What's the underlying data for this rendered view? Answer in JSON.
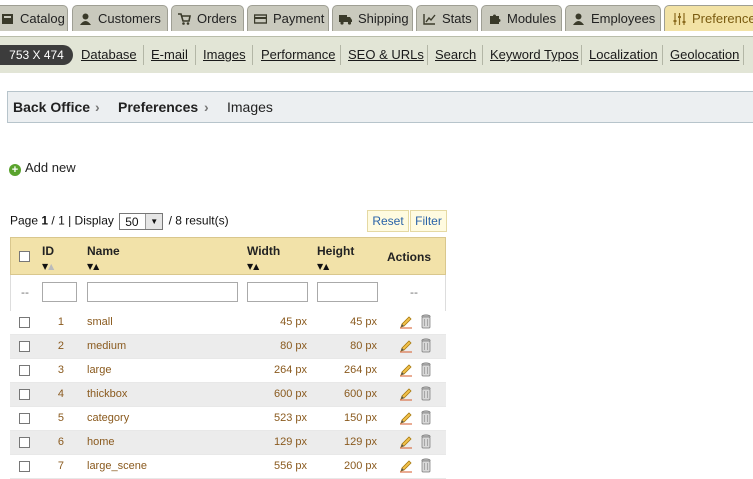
{
  "tabs": [
    {
      "label": "Catalog",
      "icon": "catalog-icon"
    },
    {
      "label": "Customers",
      "icon": "customers-icon"
    },
    {
      "label": "Orders",
      "icon": "cart-icon"
    },
    {
      "label": "Payment",
      "icon": "payment-card-icon"
    },
    {
      "label": "Shipping",
      "icon": "truck-icon"
    },
    {
      "label": "Stats",
      "icon": "stats-chart-icon"
    },
    {
      "label": "Modules",
      "icon": "puzzle-icon"
    },
    {
      "label": "Employees",
      "icon": "employees-icon"
    },
    {
      "label": "Preferences",
      "icon": "preferences-sliders-icon",
      "active": true
    }
  ],
  "size_badge": "753 X 474",
  "subnav": [
    "Database",
    "E-mail",
    "Images",
    "Performance",
    "SEO & URLs",
    "Search",
    "Keyword Typos",
    "Localization",
    "Geolocation"
  ],
  "breadcrumb": {
    "items": [
      "Back Office",
      "Preferences",
      "Images"
    ]
  },
  "add_new": "Add new",
  "pager": {
    "page_word": "Page",
    "page": "1",
    "of": "/ 1",
    "display_label": "| Display",
    "display_value": "50",
    "result": "/ 8 result(s)"
  },
  "buttons": {
    "reset": "Reset",
    "filter": "Filter"
  },
  "table": {
    "headers": {
      "id": "ID",
      "name": "Name",
      "width": "Width",
      "height": "Height",
      "actions": "Actions"
    },
    "filter_dash": "--",
    "rows": [
      {
        "id": "1",
        "name": "small",
        "width": "45 px",
        "height": "45 px"
      },
      {
        "id": "2",
        "name": "medium",
        "width": "80 px",
        "height": "80 px"
      },
      {
        "id": "3",
        "name": "large",
        "width": "264 px",
        "height": "264 px"
      },
      {
        "id": "4",
        "name": "thickbox",
        "width": "600 px",
        "height": "600 px"
      },
      {
        "id": "5",
        "name": "category",
        "width": "523 px",
        "height": "150 px"
      },
      {
        "id": "6",
        "name": "home",
        "width": "129 px",
        "height": "129 px"
      },
      {
        "id": "7",
        "name": "large_scene",
        "width": "556 px",
        "height": "200 px"
      }
    ]
  },
  "colors": {
    "tab_bg": "#c9c9bd",
    "tab_active": "#f2e2a5",
    "subnav_bg": "#e2e5d6",
    "table_header": "#f2e2a9",
    "link_brown": "#8a5a1e",
    "button_text": "#2a63a8"
  }
}
